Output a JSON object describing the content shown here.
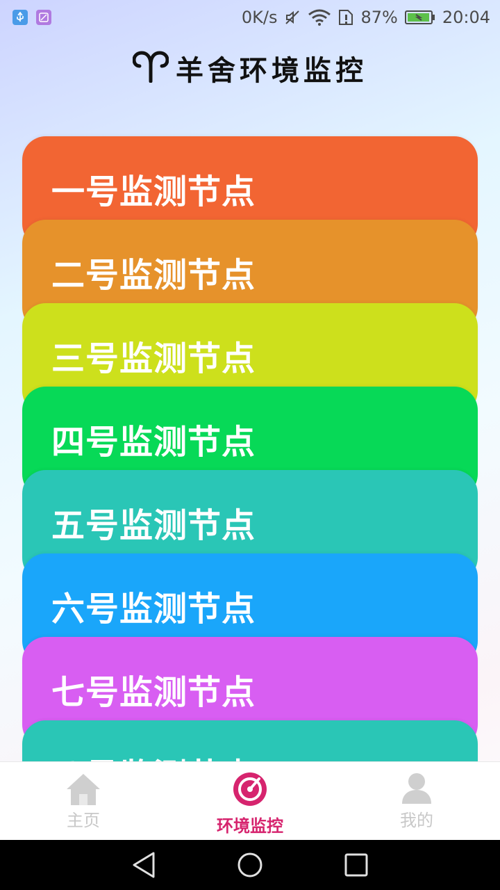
{
  "status_bar": {
    "net_speed": "0K/s",
    "battery": "87%",
    "time": "20:04"
  },
  "app": {
    "title": "羊舍环境监控",
    "logo_icon": "aries-icon"
  },
  "nodes": [
    {
      "label": "一号监测节点",
      "color": "#f26533"
    },
    {
      "label": "二号监测节点",
      "color": "#e6922b"
    },
    {
      "label": "三号监测节点",
      "color": "#cde01c"
    },
    {
      "label": "四号监测节点",
      "color": "#07d957"
    },
    {
      "label": "五号监测节点",
      "color": "#2ac6b6"
    },
    {
      "label": "六号监测节点",
      "color": "#1aa6fa"
    },
    {
      "label": "七号监测节点",
      "color": "#d85ef2"
    },
    {
      "label": "八号监测节点",
      "color": "#2ac6b6"
    }
  ],
  "bottom_nav": {
    "items": [
      {
        "label": "主页",
        "icon": "home-icon",
        "active": false
      },
      {
        "label": "环境监控",
        "icon": "monitor-target-icon",
        "active": true
      },
      {
        "label": "我的",
        "icon": "user-icon",
        "active": false
      }
    ],
    "active_color": "#d6246e",
    "inactive_color": "#c8c8c8"
  }
}
